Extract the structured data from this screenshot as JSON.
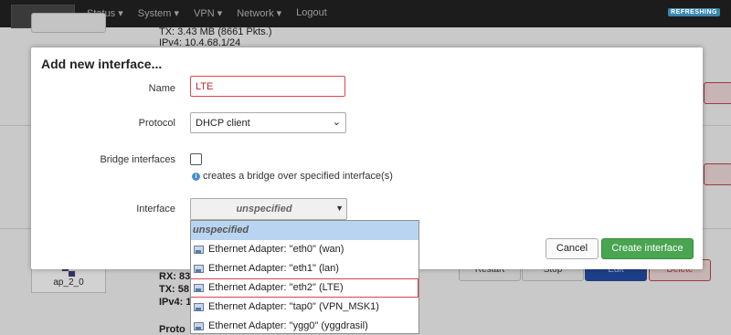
{
  "topnav": {
    "items": [
      "Status ▾",
      "System ▾",
      "VPN ▾",
      "Network ▾",
      "Logout"
    ],
    "refresh_label": "REFRESHING"
  },
  "background": {
    "tx_top": "TX: 3.43 MB (8661 Pkts.)",
    "ipv4_top": "IPv4: 10.4.68.1/24",
    "interface_name": "ap_2_0",
    "rx_bottom": "RX: 83",
    "tx_bottom": "TX: 58",
    "ipv4_bottom": "IPv4: 1",
    "proto_bottom": "Proto",
    "buttons": [
      "Restart",
      "Stop",
      "Edit",
      "Delete"
    ]
  },
  "modal": {
    "title": "Add new interface...",
    "name_label": "Name",
    "name_value": "LTE",
    "protocol_label": "Protocol",
    "protocol_value": "DHCP client",
    "bridge_label": "Bridge interfaces",
    "bridge_hint": "creates a bridge over specified interface(s)",
    "interface_label": "Interface",
    "interface_value": "unspecified",
    "cancel_label": "Cancel",
    "create_label": "Create interface"
  },
  "dropdown": {
    "selected": "unspecified",
    "options": [
      "Ethernet Adapter: \"eth0\" (wan)",
      "Ethernet Adapter: \"eth1\" (lan)",
      "Ethernet Adapter: \"eth2\" (LTE)",
      "Ethernet Adapter: \"tap0\" (VPN_MSK1)",
      "Ethernet Adapter: \"ygg0\" (yggdrasil)"
    ]
  },
  "icons": {
    "hint": "info-icon",
    "option": "network-adapter-icon",
    "select_arrow": "chevron-down-icon"
  }
}
